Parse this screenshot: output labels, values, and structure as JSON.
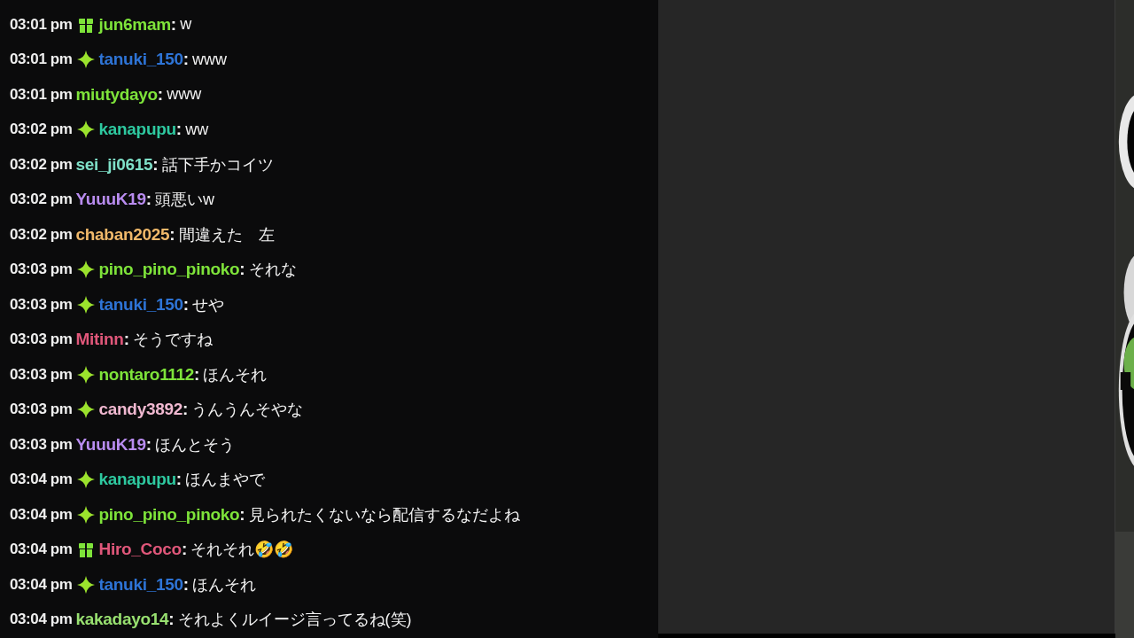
{
  "messages": [
    {
      "time": "03:01 pm",
      "kind": "gift",
      "user": "jun6mam",
      "color": "#7ee33a",
      "separator": ":",
      "text": "w"
    },
    {
      "time": "03:01 pm",
      "kind": "sparkle",
      "user": "tanuki_150",
      "color": "#2e74d6",
      "separator": ":",
      "text": "www"
    },
    {
      "time": "03:01 pm",
      "kind": "plain",
      "user": "miutydayo",
      "color": "#7ee33a",
      "separator": ":",
      "text": "www"
    },
    {
      "time": "03:02 pm",
      "kind": "sparkle",
      "user": "kanapupu",
      "color": "#2ec9a0",
      "separator": ":",
      "text": "ww"
    },
    {
      "time": "03:02 pm",
      "kind": "plain",
      "user": "sei_ji0615",
      "color": "#7fe0c8",
      "separator": ":",
      "text": "話下手かコイツ"
    },
    {
      "time": "03:02 pm",
      "kind": "plain",
      "user": "YuuuK19",
      "color": "#b98cf0",
      "separator": ":",
      "text": "頭悪いw"
    },
    {
      "time": "03:02 pm",
      "kind": "plain",
      "user": "chaban2025",
      "color": "#f0b86a",
      "separator": ":",
      "text": "間違えた　左"
    },
    {
      "time": "03:03 pm",
      "kind": "sparkle",
      "user": "pino_pino_pinoko",
      "color": "#7ee33a",
      "separator": ":",
      "text": "それな"
    },
    {
      "time": "03:03 pm",
      "kind": "sparkle",
      "user": "tanuki_150",
      "color": "#2e74d6",
      "separator": ":",
      "text": "せや"
    },
    {
      "time": "03:03 pm",
      "kind": "plain",
      "user": "Mitinn",
      "color": "#e0577a",
      "separator": ":",
      "text": "そうですね"
    },
    {
      "time": "03:03 pm",
      "kind": "sparkle",
      "user": "nontaro1112",
      "color": "#7ee33a",
      "separator": ":",
      "text": "ほんそれ"
    },
    {
      "time": "03:03 pm",
      "kind": "sparkle",
      "user": "candy3892",
      "color": "#f0b8d0",
      "separator": ":",
      "text": "うんうんそやな"
    },
    {
      "time": "03:03 pm",
      "kind": "plain",
      "user": "YuuuK19",
      "color": "#b98cf0",
      "separator": ":",
      "text": "ほんとそう"
    },
    {
      "time": "03:04 pm",
      "kind": "sparkle",
      "user": "kanapupu",
      "color": "#2ec9a0",
      "separator": ":",
      "text": "ほんまやで"
    },
    {
      "time": "03:04 pm",
      "kind": "sparkle",
      "user": "pino_pino_pinoko",
      "color": "#7ee33a",
      "separator": ":",
      "text": "見られたくないなら配信するなだよね"
    },
    {
      "time": "03:04 pm",
      "kind": "gift",
      "user": "Hiro_Coco",
      "color": "#e0577a",
      "separator": ":",
      "text": "それそれ🤣🤣"
    },
    {
      "time": "03:04 pm",
      "kind": "sparkle",
      "user": "tanuki_150",
      "color": "#2e74d6",
      "separator": ":",
      "text": "ほんそれ"
    },
    {
      "time": "03:04 pm",
      "kind": "plain",
      "user": "kakadayo14",
      "color": "#98e070",
      "separator": ":",
      "text": "それよくルイージ言ってるね(笑)"
    }
  ]
}
